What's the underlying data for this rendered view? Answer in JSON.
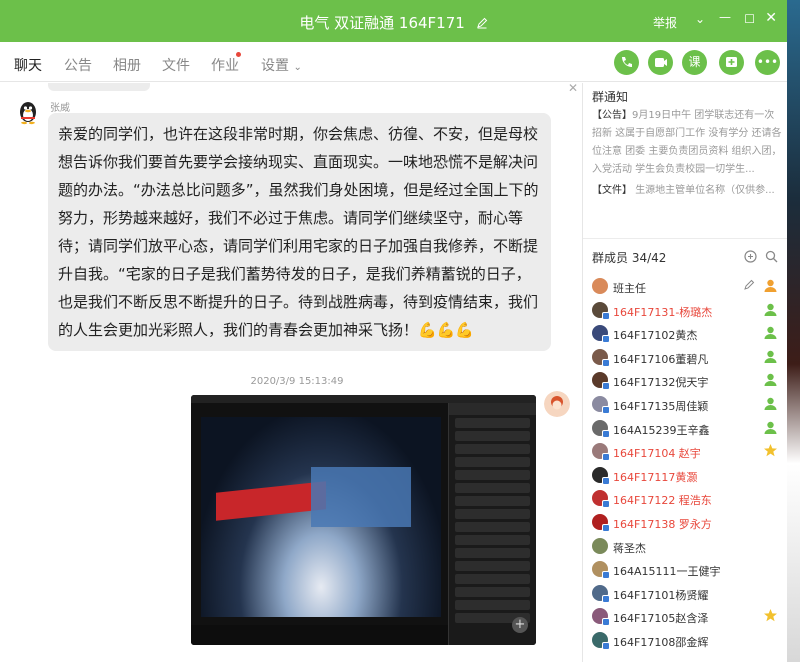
{
  "window": {
    "title": "电气 双证融通 164F171",
    "report": "举报"
  },
  "tabs": [
    {
      "label": "聊天",
      "active": true
    },
    {
      "label": "公告"
    },
    {
      "label": "相册"
    },
    {
      "label": "文件"
    },
    {
      "label": "作业",
      "dot": true
    },
    {
      "label": "设置"
    }
  ],
  "toolbar_icons": [
    {
      "icon": "phone-icon",
      "label": ""
    },
    {
      "icon": "video-icon",
      "label": ""
    },
    {
      "icon": "lesson-icon",
      "label": "课"
    },
    {
      "icon": "add-app-icon",
      "label": ""
    },
    {
      "icon": "more-icon",
      "label": "•••"
    }
  ],
  "chat": {
    "message": {
      "sender": "张威",
      "text": "亲爱的同学们，也许在这段非常时期，你会焦虑、彷徨、不安，但是母校想告诉你我们要首先要学会接纳现实、直面现实。一味地恐慌不是解决问题的办法。“办法总比问题多”，虽然我们身处困境，但是经过全国上下的努力，形势越来越好，我们不必过于焦虑。请同学们继续坚守，耐心等待；请同学们放平心态，请同学们利用宅家的日子加强自我修养，不断提升自我。“宅家的日子是我们蓄势待发的日子，是我们养精蓄锐的日子，也是我们不断反思不断提升的日子。待到战胜病毒，待到疫情结束，我们的人生会更加光彩照人，我们的青春会更加神采飞扬！💪💪💪"
    },
    "timestamp": "2020/3/9 15:13:49",
    "image_plus": "+"
  },
  "sidebar": {
    "notice_title": "群通知",
    "notice_tag": "【公告】",
    "notice_text": "9月19日中午 团学联志还有一次招新 这属于自愿部门工作 没有学分 还请各位注意 团委 主要负责团员资料 组织入团，入党活动 学生会负责校园一切学生...",
    "file_tag": "【文件】",
    "file_text": "生源地主管单位名称（仅供参...",
    "members_title": "群成员 34/42",
    "members": [
      {
        "name": "班主任",
        "red": false,
        "color": "#d98a5a",
        "badge": false,
        "role": "owner"
      },
      {
        "name": "164F17131-杨璐杰",
        "red": true,
        "color": "#5a4a3a",
        "badge": true,
        "role": "admin"
      },
      {
        "name": "164F17102黄杰",
        "red": false,
        "color": "#3a4a7a",
        "badge": true,
        "role": "admin"
      },
      {
        "name": "164F17106董碧凡",
        "red": false,
        "color": "#7a5a4a",
        "badge": true,
        "role": "admin"
      },
      {
        "name": "164F17132倪天宇",
        "red": false,
        "color": "#5a3a2a",
        "badge": true,
        "role": "admin"
      },
      {
        "name": "164F17135周佳颖",
        "red": false,
        "color": "#8a8aa0",
        "badge": true,
        "role": "admin-star"
      },
      {
        "name": "164A15239王辛鑫",
        "red": false,
        "color": "#6a6a6a",
        "badge": true,
        "role": "admin-star"
      },
      {
        "name": "164F17104  赵宇",
        "red": true,
        "color": "#9a7a7a",
        "badge": true,
        "role": "star"
      },
      {
        "name": "164F17117黄灏",
        "red": true,
        "color": "#2a2a2a",
        "badge": true,
        "role": ""
      },
      {
        "name": "164F17122 程浩东",
        "red": true,
        "color": "#c03030",
        "badge": true,
        "role": ""
      },
      {
        "name": "164F17138 罗永方",
        "red": true,
        "color": "#b02020",
        "badge": true,
        "role": ""
      },
      {
        "name": "蒋圣杰",
        "red": false,
        "color": "#7a8a5a",
        "badge": false,
        "role": ""
      },
      {
        "name": "164A15111一王健宇",
        "red": false,
        "color": "#b09060",
        "badge": true,
        "role": ""
      },
      {
        "name": "164F17101杨贤耀",
        "red": false,
        "color": "#506a8a",
        "badge": true,
        "role": ""
      },
      {
        "name": "164F17105赵含泽",
        "red": false,
        "color": "#8a5a7a",
        "badge": true,
        "role": "star"
      },
      {
        "name": "164F17108邵金辉",
        "red": false,
        "color": "#3a6a6a",
        "badge": true,
        "role": ""
      }
    ]
  },
  "colors": {
    "brand_green": "#6cc04a",
    "red_name": "#e8473b",
    "bubble": "#ececec"
  }
}
